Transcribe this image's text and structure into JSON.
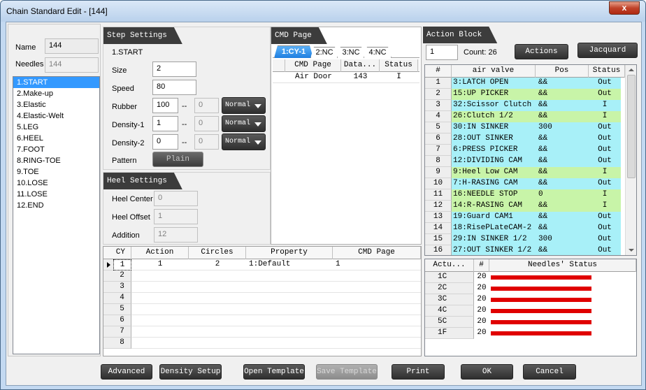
{
  "window": {
    "title": "Chain Standard Edit - [144]",
    "close_label": "x"
  },
  "left": {
    "name_label": "Name",
    "name_value": "144",
    "needles_label": "Needles",
    "needles_value": "144",
    "steps": [
      "1.START",
      "2.Make-up",
      "3.Elastic",
      "4.Elastic-Welt",
      "5.LEG",
      "6.HEEL",
      "7.FOOT",
      "8.RING-TOE",
      "9.TOE",
      "10.LOSE",
      "11.LOSE",
      "12.END"
    ]
  },
  "step_settings": {
    "header": "Step Settings",
    "current_step": "1.START",
    "size_label": "Size",
    "size_value": "2",
    "speed_label": "Speed",
    "speed_value": "80",
    "rubber_label": "Rubber",
    "rubber_value": "100",
    "rubber_value2": "0",
    "rubber_mode": "Normal",
    "density1_label": "Density-1",
    "density1_value": "1",
    "density1_value2": "0",
    "density1_mode": "Normal",
    "density2_label": "Density-2",
    "density2_value": "0",
    "density2_value2": "0",
    "density2_mode": "Normal",
    "sep": "--",
    "pattern_label": "Pattern",
    "pattern_button": "Plain"
  },
  "heel_settings": {
    "header": "Heel Settings",
    "center_label": "Heel Center",
    "center_value": "0",
    "offset_label": "Heel Offset",
    "offset_value": "1",
    "addition_label": "Addition",
    "addition_value": "12"
  },
  "cmd_page": {
    "header": "CMD Page",
    "tabs": [
      "1:CY-1",
      "2:NC",
      "3:NC",
      "4:NC"
    ],
    "columns": [
      "CMD Page",
      "Data...",
      "Status"
    ],
    "rows": [
      {
        "cmd": "Air Door",
        "data": "143",
        "status": "I"
      }
    ]
  },
  "cy_grid": {
    "columns": [
      "CY",
      "Action",
      "Circles",
      "Property",
      "CMD Page"
    ],
    "rows": [
      {
        "cy": "1",
        "action": "1",
        "circles": "2",
        "property": "1:Default",
        "cmd": "1"
      },
      {
        "cy": "2",
        "action": "",
        "circles": "",
        "property": "",
        "cmd": ""
      },
      {
        "cy": "3",
        "action": "",
        "circles": "",
        "property": "",
        "cmd": ""
      },
      {
        "cy": "4",
        "action": "",
        "circles": "",
        "property": "",
        "cmd": ""
      },
      {
        "cy": "5",
        "action": "",
        "circles": "",
        "property": "",
        "cmd": ""
      },
      {
        "cy": "6",
        "action": "",
        "circles": "",
        "property": "",
        "cmd": ""
      },
      {
        "cy": "7",
        "action": "",
        "circles": "",
        "property": "",
        "cmd": ""
      },
      {
        "cy": "8",
        "action": "",
        "circles": "",
        "property": "",
        "cmd": ""
      }
    ]
  },
  "action_block": {
    "header": "Action Block",
    "value": "1",
    "count_label": "Count: 26",
    "actions_button": "Actions",
    "jacquard_button": "Jacquard",
    "columns": [
      "#",
      "air valve",
      "Pos",
      "Status"
    ],
    "rows": [
      {
        "n": "1",
        "valve": "3:LATCH OPEN",
        "pos": "&&",
        "status": "Out",
        "color": "#a8f0f8"
      },
      {
        "n": "2",
        "valve": "15:UP PICKER",
        "pos": "&&",
        "status": "Out",
        "color": "#c8f4a8"
      },
      {
        "n": "3",
        "valve": "32:Scissor Clutch",
        "pos": "&&",
        "status": "I",
        "color": "#a8f0f8"
      },
      {
        "n": "4",
        "valve": "26:Clutch  1/2",
        "pos": "&&",
        "status": "I",
        "color": "#c8f4a8"
      },
      {
        "n": "5",
        "valve": "30:IN SINKER",
        "pos": "300",
        "status": "Out",
        "color": "#a8f0f8"
      },
      {
        "n": "6",
        "valve": "28:OUT SINKER",
        "pos": "&&",
        "status": "Out",
        "color": "#a8f0f8"
      },
      {
        "n": "7",
        "valve": "6:PRESS PICKER",
        "pos": "&&",
        "status": "Out",
        "color": "#a8f0f8"
      },
      {
        "n": "8",
        "valve": "12:DIVIDING CAM",
        "pos": "&&",
        "status": "Out",
        "color": "#a8f0f8"
      },
      {
        "n": "9",
        "valve": "9:Heel Low CAM",
        "pos": "&&",
        "status": "I",
        "color": "#c8f4a8"
      },
      {
        "n": "10",
        "valve": "7:H-RASING CAM",
        "pos": "&&",
        "status": "Out",
        "color": "#a8f0f8"
      },
      {
        "n": "11",
        "valve": "16:NEEDLE STOP",
        "pos": "0",
        "status": "I",
        "color": "#c8f4a8"
      },
      {
        "n": "12",
        "valve": "14:R-RASING CAM",
        "pos": "&&",
        "status": "I",
        "color": "#c8f4a8"
      },
      {
        "n": "13",
        "valve": "19:Guard CAM1",
        "pos": "&&",
        "status": "Out",
        "color": "#a8f0f8"
      },
      {
        "n": "14",
        "valve": "18:RisePLateCAM-2",
        "pos": "&&",
        "status": "Out",
        "color": "#a8f0f8"
      },
      {
        "n": "15",
        "valve": "29:IN SINKER 1/2",
        "pos": "300",
        "status": "Out",
        "color": "#a8f0f8"
      },
      {
        "n": "16",
        "valve": "27:OUT SINKER 1/2",
        "pos": "&&",
        "status": "Out",
        "color": "#a8f0f8"
      }
    ]
  },
  "needles": {
    "columns": [
      "Actu...",
      "#",
      "Needles' Status"
    ],
    "rows": [
      {
        "act": "1C",
        "n": "20",
        "fill": 1.0
      },
      {
        "act": "2C",
        "n": "20",
        "fill": 1.0
      },
      {
        "act": "3C",
        "n": "20",
        "fill": 1.0
      },
      {
        "act": "4C",
        "n": "20",
        "fill": 1.0
      },
      {
        "act": "5C",
        "n": "20",
        "fill": 1.0
      },
      {
        "act": "1F",
        "n": "20",
        "fill": 1.0
      }
    ]
  },
  "bottom_buttons": {
    "advanced": "Advanced",
    "density_setup": "Density Setup",
    "open_template": "Open Template",
    "save_template": "Save Template",
    "print": "Print",
    "ok": "OK",
    "cancel": "Cancel"
  }
}
